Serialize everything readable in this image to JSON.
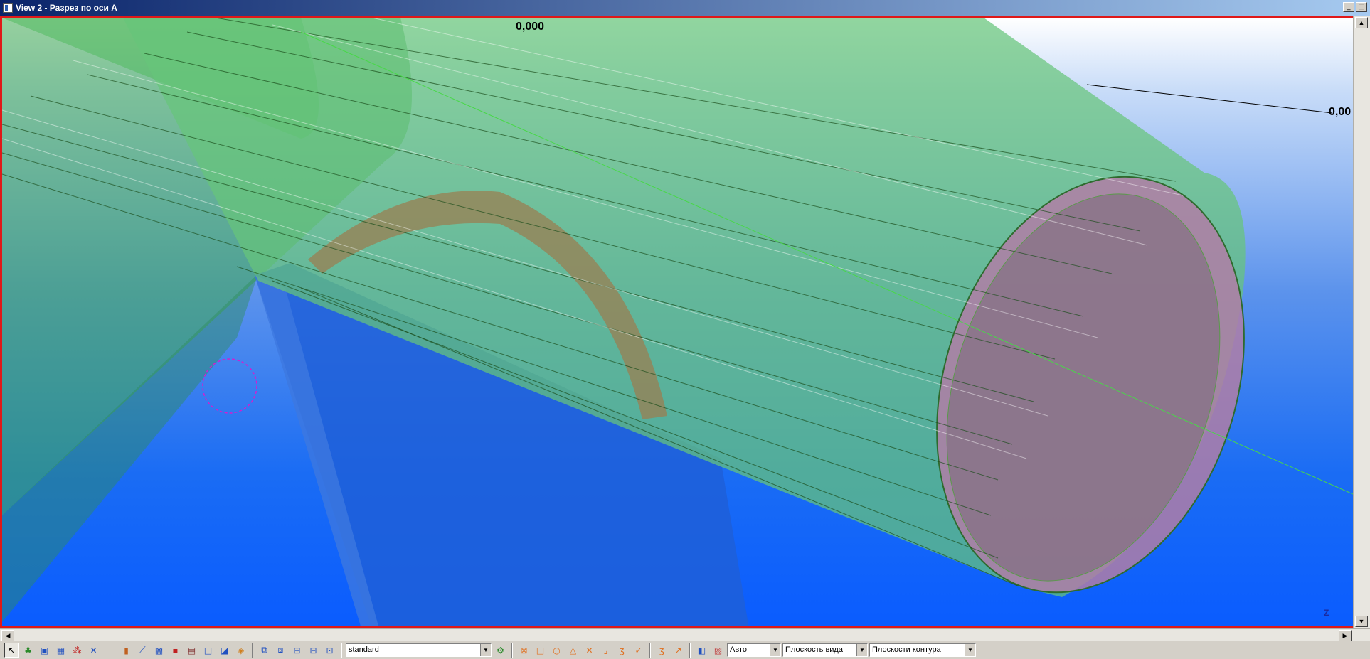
{
  "window": {
    "title": "View 2 - Разрез по оси А",
    "minimize_glyph": "_",
    "maximize_glyph": "□"
  },
  "viewport": {
    "level_labels": [
      "0,000",
      "0,00"
    ],
    "axis_indicator": "Z"
  },
  "statusbar": {
    "toolbar_icons_left": [
      "select-icon",
      "tree-icon",
      "point-snap-icon",
      "midpoint-snap-icon",
      "grid-snap-icon",
      "intersection-snap-icon",
      "perpendicular-snap-icon",
      "line-snap-icon",
      "extension-snap-icon",
      "free-snap-icon",
      "nearest-snap-icon",
      "component-snap-icon",
      "part-snap-icon",
      "reference-snap-icon",
      "plane-snap-icon",
      "select-all-icon",
      "select-parts-icon",
      "select-assembly-icon",
      "select-welds-icon",
      "select-bolts-icon"
    ],
    "phase_filter": "standard",
    "snap_icons": [
      "end-point-icon",
      "center-icon",
      "circle-icon",
      "triangle-icon",
      "cross-icon",
      "corner-icon",
      "tangent-icon",
      "check-icon",
      "custom-icon",
      "arrow-icon"
    ],
    "view_mode": "Авто",
    "work_plane": "Плоскость вида",
    "contour_planes": "Плоскости контура"
  },
  "colors": {
    "frame_red": "#e01818",
    "pipe_green": "#5cbf6a",
    "plate_blue": "#1f5fd8",
    "end_cap_pink": "#c08ab0"
  }
}
